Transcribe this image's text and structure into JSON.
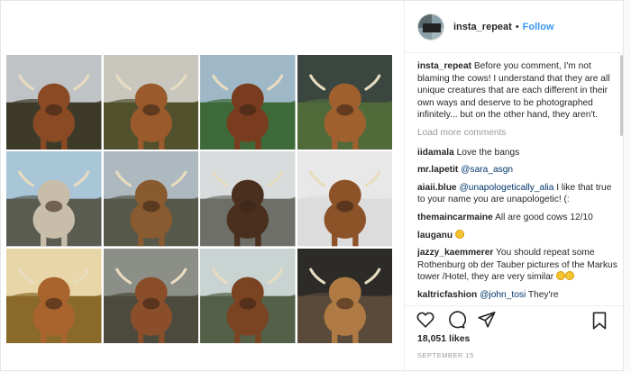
{
  "header": {
    "username": "insta_repeat",
    "separator": "•",
    "follow_label": "Follow"
  },
  "caption": {
    "user": "insta_repeat",
    "text": "Before you comment, I'm not blaming the cows! I understand that they are all unique creatures that are each different in their own ways and deserve to be photographed infinitely... but on the other hand, they aren't."
  },
  "load_more": "Load more comments",
  "comments": [
    {
      "user": "iidamala",
      "text": "Love the bangs"
    },
    {
      "user": "mr.lapetit",
      "mention": "@sara_asgn",
      "text": ""
    },
    {
      "user": "aiaii.blue",
      "mention": "@unapologetically_alia",
      "text": "I like that true to your name you are unapologetic! (:"
    },
    {
      "user": "themaincarmaine",
      "text": "All are good cows 12/10"
    },
    {
      "user": "lauganu",
      "text": ""
    },
    {
      "user": "jazzy_kaemmerer",
      "text": "You should repeat some Rothenburg ob der Tauber pictures of the Markus tower /Hotel, they are very similar"
    },
    {
      "user": "kaltricfashion",
      "mention": "@john_tosi",
      "text": "They're"
    }
  ],
  "likes": "18,051 likes",
  "date": "SEPTEMBER 15",
  "icons": {
    "like": "heart-icon",
    "comment": "comment-icon",
    "share": "share-icon",
    "save": "bookmark-icon"
  },
  "tiles": [
    {
      "sky": "#bfc3c6",
      "ground": "#3d3a2a",
      "cow": "#8a4a24"
    },
    {
      "sky": "#c9c7bd",
      "ground": "#52512e",
      "cow": "#9a5a2c"
    },
    {
      "sky": "#9fb8c8",
      "ground": "#3e6a3a",
      "cow": "#7a3c1e"
    },
    {
      "sky": "#3b4640",
      "ground": "#506a3a",
      "cow": "#a0602e"
    },
    {
      "sky": "#a9c5d8",
      "ground": "#5a5c52",
      "cow": "#c8bda8"
    },
    {
      "sky": "#aeb9bf",
      "ground": "#56594a",
      "cow": "#8a5a30"
    },
    {
      "sky": "#d8dcdd",
      "ground": "#6e6f68",
      "cow": "#4a2e1e"
    },
    {
      "sky": "#e8e8e8",
      "ground": "#dcdcdc",
      "cow": "#8c5228"
    },
    {
      "sky": "#e9d6a8",
      "ground": "#8a6a2a",
      "cow": "#a8642c"
    },
    {
      "sky": "#8b8f87",
      "ground": "#4b4a3c",
      "cow": "#8a4e2a"
    },
    {
      "sky": "#c9d3d2",
      "ground": "#556049",
      "cow": "#7a4322"
    },
    {
      "sky": "#2c2b28",
      "ground": "#5a4a3a",
      "cow": "#b07a44"
    }
  ]
}
